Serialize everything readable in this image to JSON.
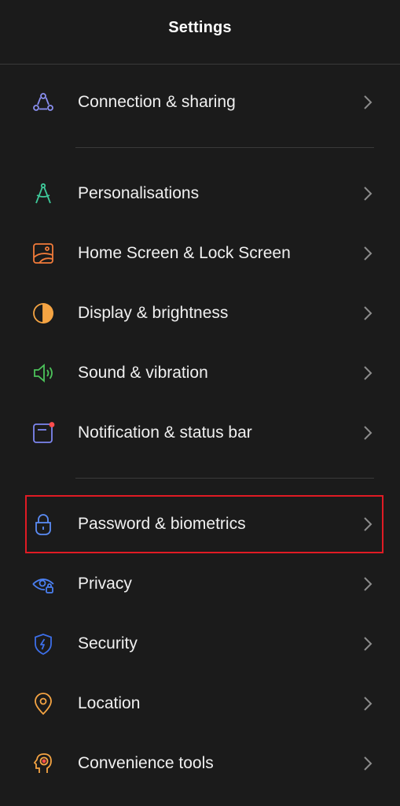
{
  "header": {
    "title": "Settings"
  },
  "groups": [
    {
      "items": [
        {
          "label": "Connection & sharing",
          "icon": "share-nodes-icon",
          "color": "#8a8ff0"
        }
      ]
    },
    {
      "items": [
        {
          "label": "Personalisations",
          "icon": "compass-tool-icon",
          "color": "#3ec99a"
        },
        {
          "label": "Home Screen & Lock Screen",
          "icon": "wallpaper-icon",
          "color": "#f27b3a"
        },
        {
          "label": "Display & brightness",
          "icon": "contrast-icon",
          "color": "#f5a443"
        },
        {
          "label": "Sound & vibration",
          "icon": "speaker-icon",
          "color": "#4cc35a"
        },
        {
          "label": "Notification & status bar",
          "icon": "notification-icon",
          "color": "#7d86f0"
        }
      ]
    },
    {
      "items": [
        {
          "label": "Password & biometrics",
          "icon": "lock-icon",
          "color": "#5b8cf5",
          "highlighted": true
        },
        {
          "label": "Privacy",
          "icon": "privacy-eye-icon",
          "color": "#4a7ff0"
        },
        {
          "label": "Security",
          "icon": "shield-icon",
          "color": "#3d6fe8"
        },
        {
          "label": "Location",
          "icon": "location-pin-icon",
          "color": "#f5a443"
        },
        {
          "label": "Convenience tools",
          "icon": "convenience-tools-icon",
          "color": "#f5a443"
        }
      ]
    }
  ],
  "highlight_color": "#e01b24"
}
